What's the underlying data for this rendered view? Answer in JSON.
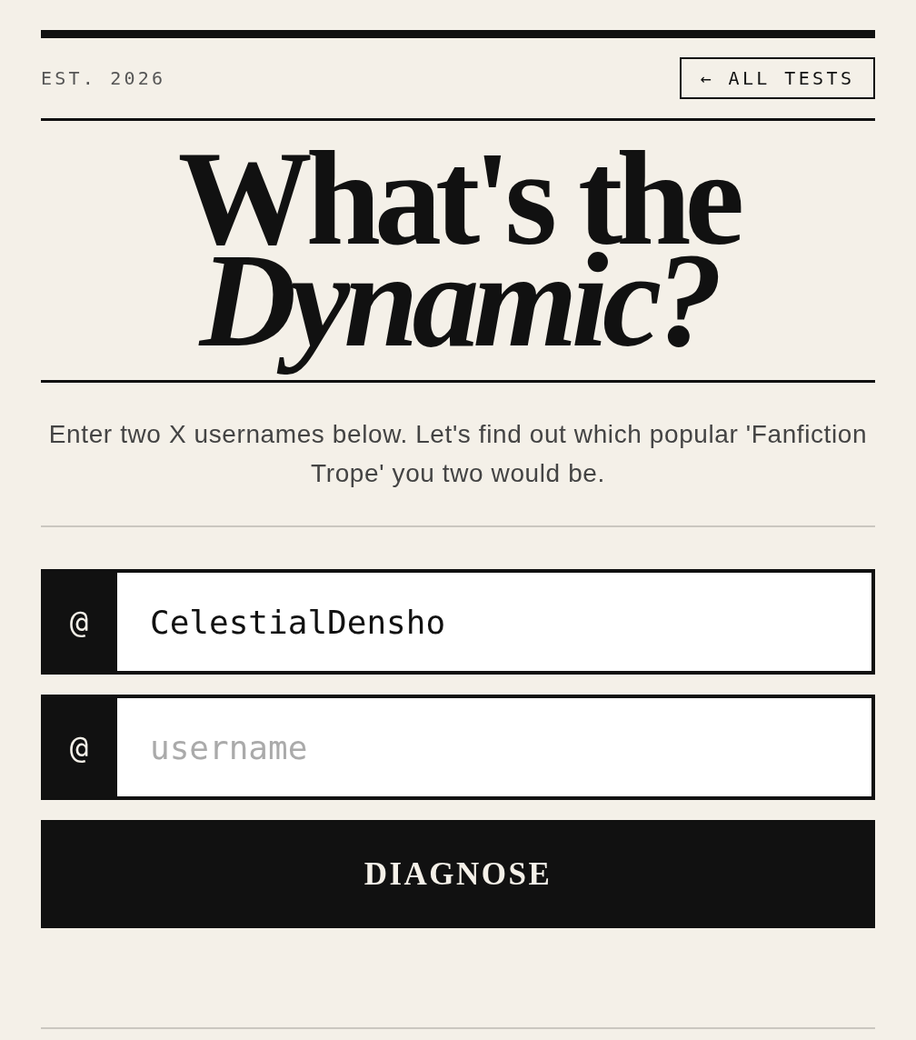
{
  "header": {
    "established": "EST. 2026",
    "back_button": "← ALL TESTS"
  },
  "title": "What's the *Dynamic?*",
  "intro": "Enter two X usernames below. Let's find out which popular 'Fanfiction Trope' you two would be.",
  "fields": [
    {
      "prefix": "@",
      "value": "CelestialDensho"
    },
    {
      "prefix": "@",
      "placeholder": "username"
    }
  ],
  "submit_button": "DIAGNOSE"
}
